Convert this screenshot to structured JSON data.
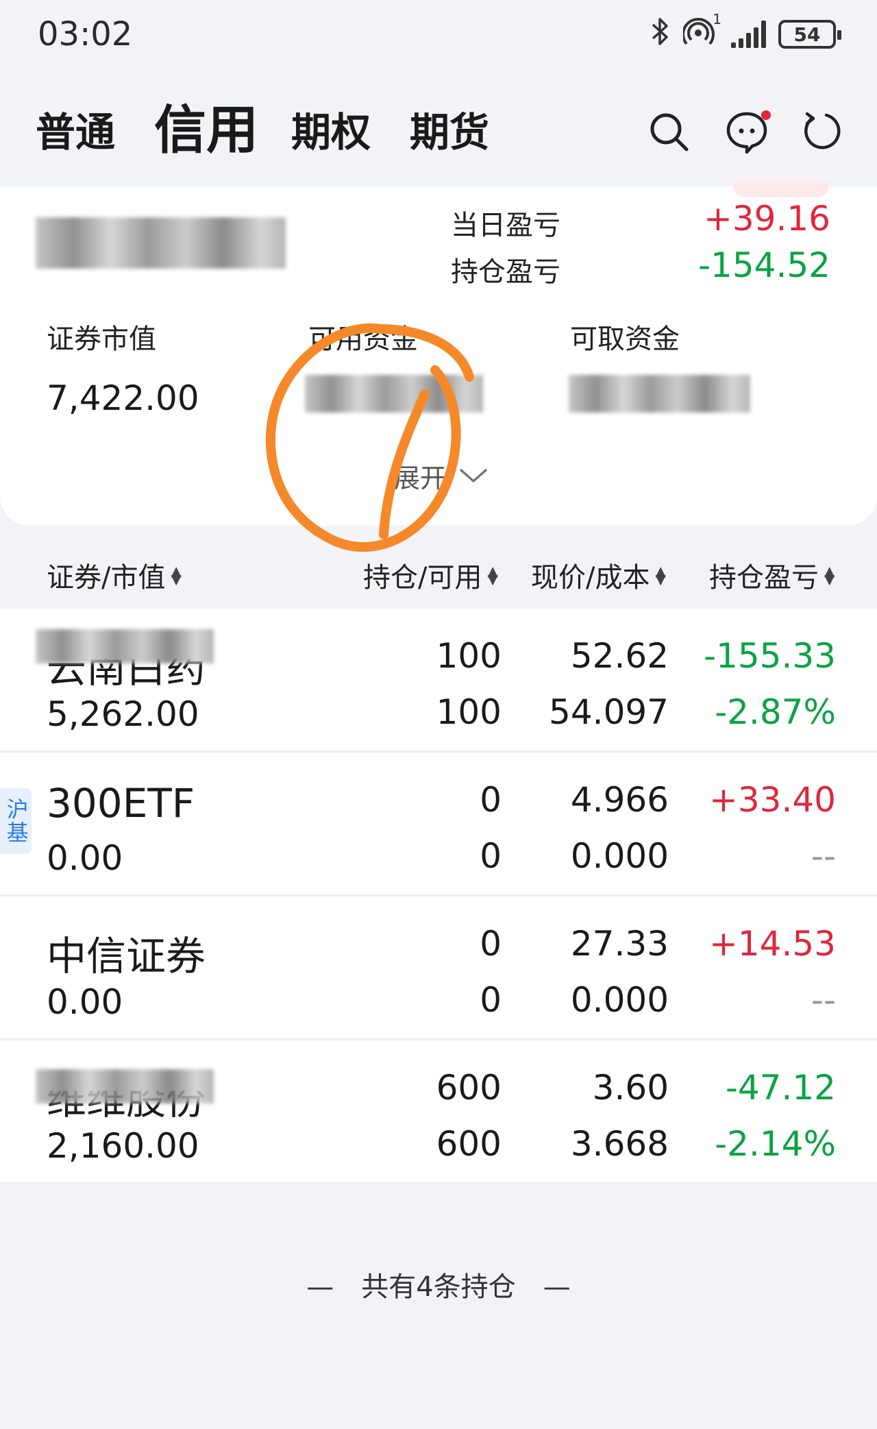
{
  "status_bar": {
    "time": "03:02",
    "battery": "54",
    "hotspot_badge": "1",
    "icons": [
      "bluetooth-icon",
      "hotspot-icon",
      "signal-icon",
      "battery-icon"
    ]
  },
  "tabs": [
    {
      "label": "普通",
      "active": false
    },
    {
      "label": "信用",
      "active": true
    },
    {
      "label": "期权",
      "active": false
    },
    {
      "label": "期货",
      "active": false
    }
  ],
  "header_icons": [
    "search-icon",
    "message-icon",
    "refresh-icon"
  ],
  "summary": {
    "daily_pnl_label": "当日盈亏",
    "daily_pnl_value": "+39.16",
    "position_pnl_label": "持仓盈亏",
    "position_pnl_value": "-154.52",
    "market_value_label": "证券市值",
    "market_value": "7,422.00",
    "available_funds_label": "可用资金",
    "withdrawable_funds_label": "可取资金",
    "expand_label": "展开"
  },
  "columns": [
    {
      "label": "证券/市值"
    },
    {
      "label": "持仓/可用"
    },
    {
      "label": "现价/成本"
    },
    {
      "label": "持仓盈亏"
    }
  ],
  "holdings": [
    {
      "name": "云南白药",
      "market_value": "5,262.00",
      "position": "100",
      "available": "100",
      "price": "52.62",
      "cost": "54.097",
      "pnl": "-155.33",
      "pnl_pct": "-2.87%",
      "pnl_color": "#0aa343",
      "pct_color": "#0aa343",
      "tag": ""
    },
    {
      "name": "300ETF",
      "market_value": "0.00",
      "position": "0",
      "available": "0",
      "price": "4.966",
      "cost": "0.000",
      "pnl": "+33.40",
      "pnl_pct": "--",
      "pnl_color": "#e0263a",
      "pct_color": "#999999",
      "tag": "沪基"
    },
    {
      "name": "中信证券",
      "market_value": "0.00",
      "position": "0",
      "available": "0",
      "price": "27.33",
      "cost": "0.000",
      "pnl": "+14.53",
      "pnl_pct": "--",
      "pnl_color": "#e0263a",
      "pct_color": "#999999",
      "tag": ""
    },
    {
      "name": "维维股份",
      "market_value": "2,160.00",
      "position": "600",
      "available": "600",
      "price": "3.60",
      "cost": "3.668",
      "pnl": "-47.12",
      "pnl_pct": "-2.14%",
      "pnl_color": "#0aa343",
      "pct_color": "#0aa343",
      "tag": ""
    }
  ],
  "footer": {
    "count_text": "—　共有4条持仓　—"
  },
  "colors": {
    "up": "#e0263a",
    "down": "#0aa343",
    "annotation": "#f5892a",
    "tag_blue": "#2b7ce9"
  }
}
